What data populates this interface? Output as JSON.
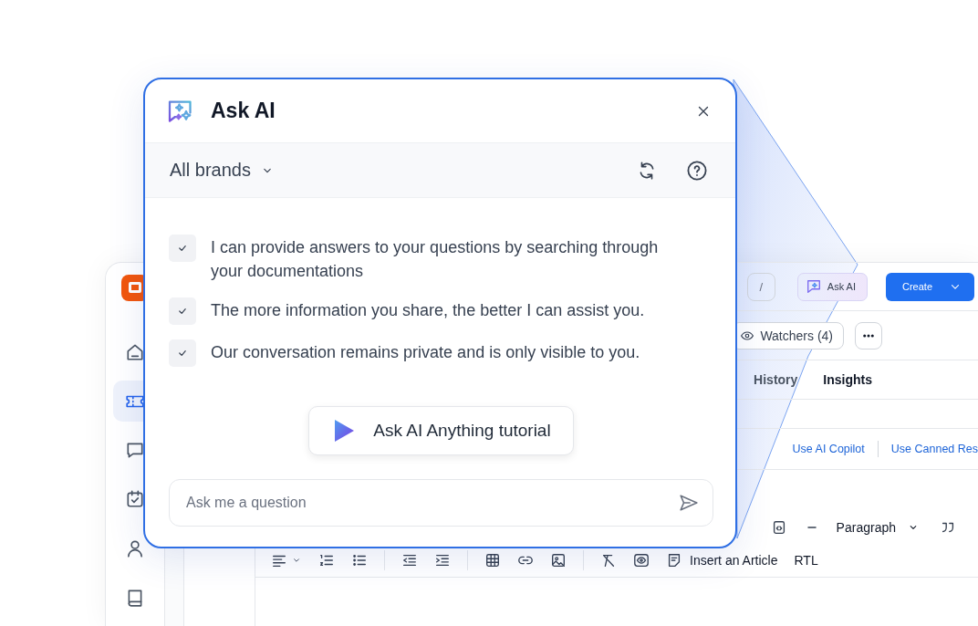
{
  "app": {
    "sidebar": {
      "items": [
        {
          "selected": false
        },
        {
          "selected": true
        },
        {
          "selected": false
        },
        {
          "selected": false
        },
        {
          "selected": false
        },
        {
          "selected": false
        }
      ]
    },
    "top_bar": {
      "shortcut_key": "/",
      "ask_ai_button": "Ask AI",
      "create_button": "Create"
    },
    "watchers_button": "Watchers (4)",
    "tabs": [
      {
        "label": "History",
        "selected": false
      },
      {
        "label": "Insights",
        "selected": true
      }
    ],
    "reply_actions": [
      "Use AI Copilot",
      "Use Canned Res"
    ],
    "editor_toolbar": {
      "block_format": "Paragraph",
      "insert_article": "Insert an Article",
      "text_direction": "RTL"
    }
  },
  "popup": {
    "title": "Ask AI",
    "brand_select": "All brands",
    "capabilities": [
      {
        "text": "I can provide answers to your questions by searching through your documentations",
        "checked": true
      },
      {
        "text": "The more information you share, the better I can assist you.",
        "checked": true
      },
      {
        "text": "Our conversation remains private and is only visible to you.",
        "checked": true
      }
    ],
    "tutorial_button": "Ask AI Anything tutorial",
    "question_field": {
      "placeholder": "Ask me a question"
    }
  }
}
